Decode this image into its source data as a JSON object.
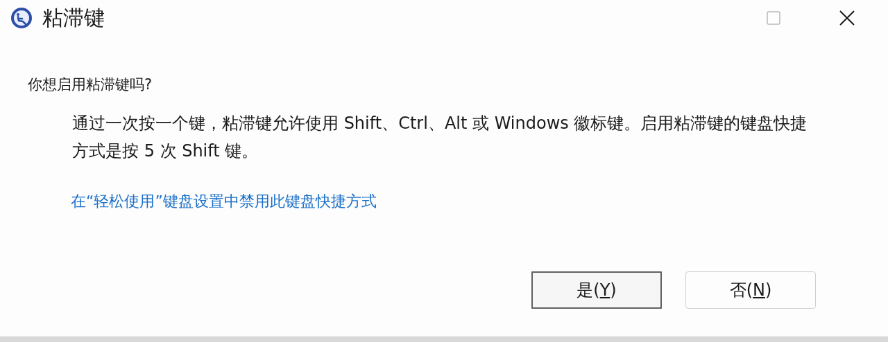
{
  "window": {
    "title": "粘滞键",
    "maximize_disabled": true
  },
  "question": "你想启用粘滞键吗?",
  "description": "通过一次按一个键，粘滞键允许使用 Shift、Ctrl、Alt 或 Windows 徽标键。启用粘滞键的键盘快捷方式是按 5 次 Shift 键。",
  "link": "在“轻松使用”键盘设置中禁用此键盘快捷方式",
  "buttons": [
    {
      "before": "是(",
      "key": "Y",
      "after": ")",
      "selected": true
    },
    {
      "before": "否(",
      "key": "N",
      "after": ")",
      "selected": false
    }
  ]
}
